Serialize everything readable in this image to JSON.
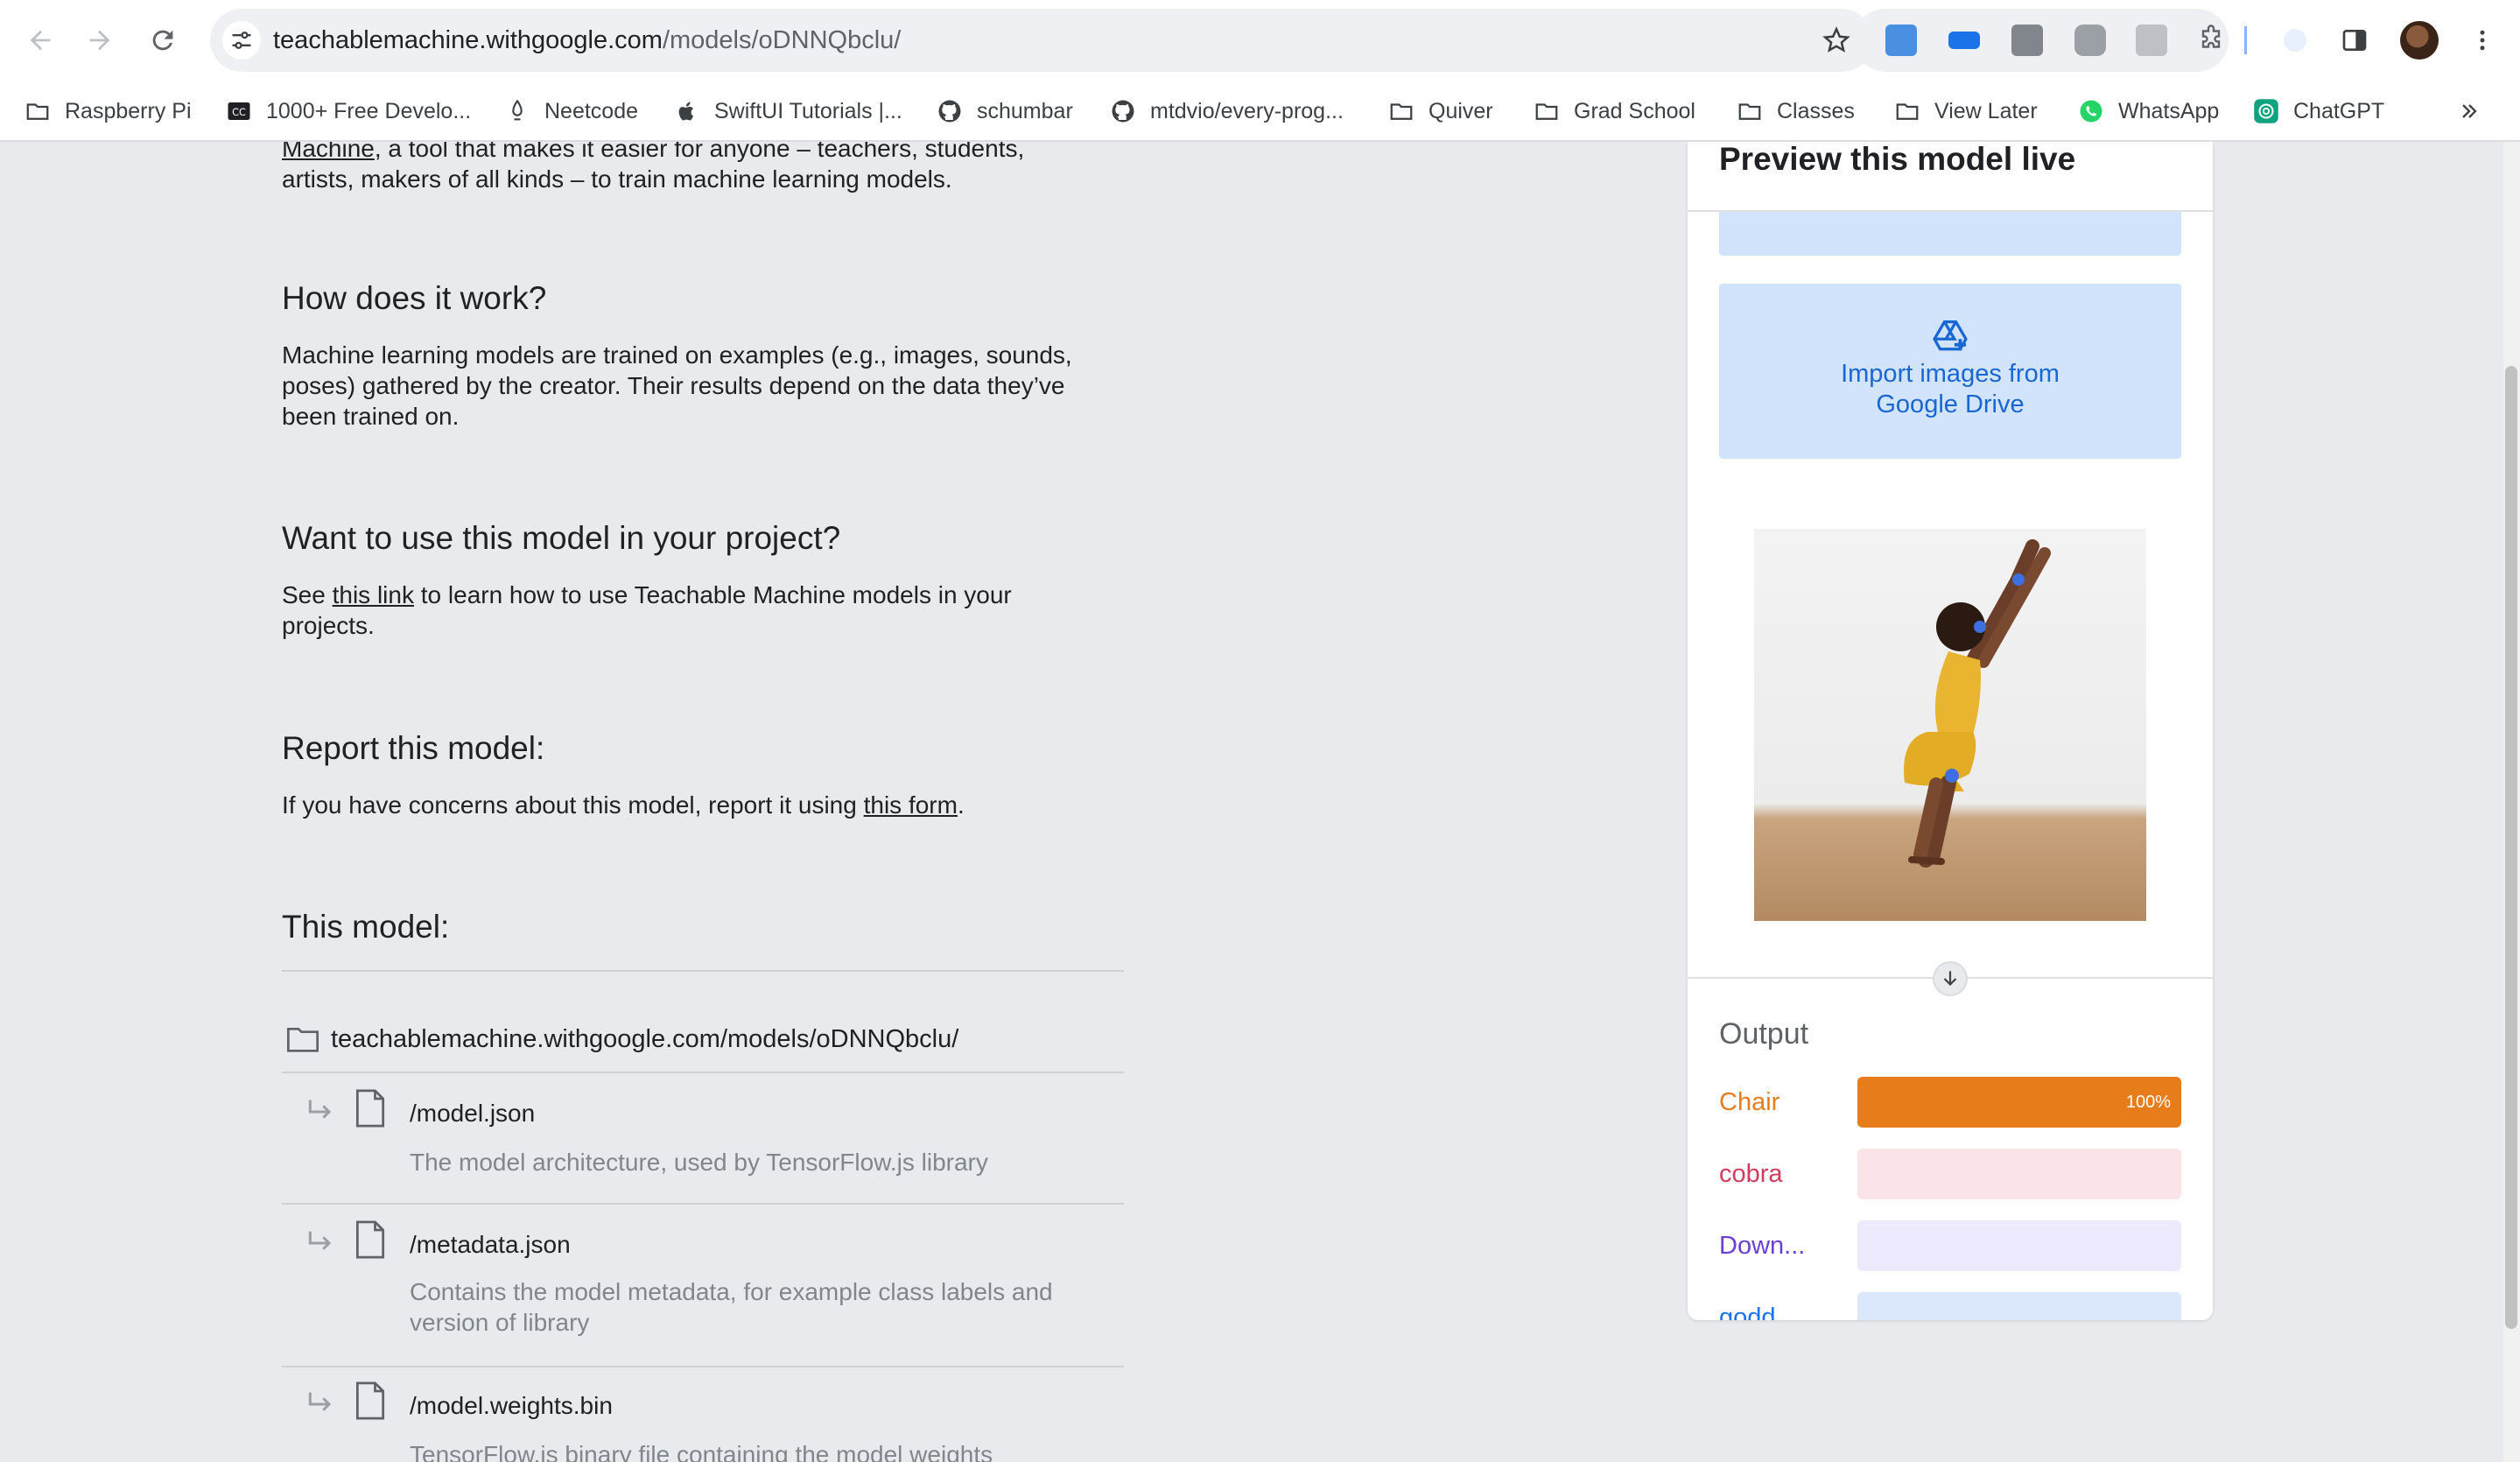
{
  "browser": {
    "url_host": "teachablemachine.withgoogle.com",
    "url_path": "/models/oDNNQbclu/"
  },
  "bookmarks": [
    {
      "label": "Raspberry Pi",
      "icon": "folder-icon"
    },
    {
      "label": "1000+ Free Develo...",
      "icon": "cc-icon"
    },
    {
      "label": "Neetcode",
      "icon": "neetcode-icon"
    },
    {
      "label": "SwiftUI Tutorials |...",
      "icon": "apple-icon"
    },
    {
      "label": "schumbar",
      "icon": "github-icon"
    },
    {
      "label": "mtdvio/every-prog...",
      "icon": "github-icon"
    },
    {
      "label": "Quiver",
      "icon": "folder-icon"
    },
    {
      "label": "Grad School",
      "icon": "folder-icon"
    },
    {
      "label": "Classes",
      "icon": "folder-icon"
    },
    {
      "label": "View Later",
      "icon": "folder-icon"
    },
    {
      "label": "WhatsApp",
      "icon": "whatsapp-icon"
    },
    {
      "label": "ChatGPT",
      "icon": "chatgpt-icon"
    }
  ],
  "content": {
    "intro_link": "Machine",
    "intro_rest_1": ", a tool that makes it easier for anyone – teachers, students,",
    "intro_line_2": "artists, makers of all kinds – to train machine learning models.",
    "how_heading": "How does it work?",
    "how_body": "Machine learning models are trained on examples (e.g., images, sounds, poses) gathered by the creator. Their results depend on the data they’ve been trained on.",
    "use_heading": "Want to use this model in your project?",
    "use_pre": "See ",
    "use_link": "this link",
    "use_post": " to learn how to use Teachable Machine models in your projects.",
    "report_heading": "Report this model:",
    "report_pre": "If you have concerns about this model, report it using ",
    "report_link": "this form",
    "report_post": ".",
    "model_heading": "This model:",
    "folder_path": "teachablemachine.withgoogle.com/models/oDNNQbclu/",
    "files": [
      {
        "name": "/model.json",
        "desc": "The model architecture, used by TensorFlow.js library"
      },
      {
        "name": "/metadata.json",
        "desc": "Contains the model metadata, for example class labels and version of library"
      },
      {
        "name": "/model.weights.bin",
        "desc": "TensorFlow.js binary file containing the model weights"
      }
    ]
  },
  "preview": {
    "title": "Preview this model live",
    "drive_button": "Import images from Google Drive",
    "output_label": "Output",
    "classes": [
      {
        "name": "Chair",
        "value": 1.0,
        "pct_label": "100%",
        "color": "#e67c1a",
        "track": "#fbe3cc"
      },
      {
        "name": "cobra",
        "value": 0.0,
        "pct_label": "",
        "color": "#d33b5c",
        "track": "#fbe4e8"
      },
      {
        "name": "Down...",
        "value": 0.0,
        "pct_label": "",
        "color": "#6b3fd4",
        "track": "#eceafc"
      },
      {
        "name": "godd",
        "value": 0.0,
        "pct_label": "",
        "color": "#1a73e8",
        "track": "#dbe7fb"
      }
    ]
  }
}
